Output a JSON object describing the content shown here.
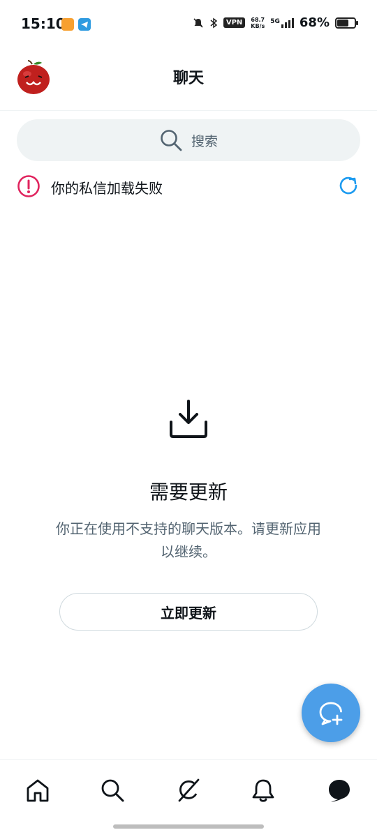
{
  "status_bar": {
    "time": "15:10",
    "vpn": "VPN",
    "net_speed_value": "68.7",
    "net_speed_unit": "KB/s",
    "network": "5G",
    "battery_percent": "68%",
    "battery_level": 0.68
  },
  "header": {
    "title": "聊天",
    "avatar": "apple-avatar"
  },
  "search": {
    "placeholder": "搜索",
    "icon": "search-icon"
  },
  "error": {
    "message": "你的私信加载失败",
    "icon": "alert-circle-icon",
    "retry_icon": "refresh-icon",
    "color": "#e0245e"
  },
  "empty_state": {
    "icon": "download-icon",
    "title": "需要更新",
    "description": "你正在使用不支持的聊天版本。请更新应用以继续。",
    "button_label": "立即更新"
  },
  "fab": {
    "icon": "new-message-icon",
    "color": "#4c9ee8"
  },
  "bottom_nav": {
    "items": [
      {
        "name": "home",
        "icon": "home-icon"
      },
      {
        "name": "search",
        "icon": "search-icon"
      },
      {
        "name": "grok",
        "icon": "grok-icon"
      },
      {
        "name": "notifications",
        "icon": "bell-icon"
      },
      {
        "name": "messages",
        "icon": "chat-bubble-icon",
        "active": true
      }
    ]
  },
  "colors": {
    "accent": "#1d9bf0",
    "text": "#0f1419",
    "secondary_text": "#536471",
    "search_bg": "#eff3f4"
  }
}
